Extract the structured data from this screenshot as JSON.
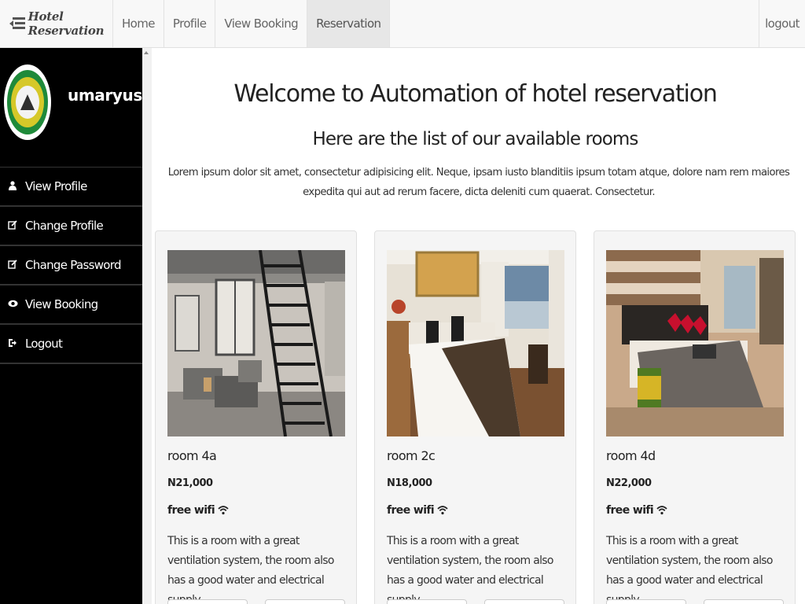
{
  "navbar": {
    "brand": "Hotel Reservation",
    "links": [
      "Home",
      "Profile",
      "View Booking",
      "Reservation"
    ],
    "active_index": 3,
    "logout": "logout"
  },
  "sidebar": {
    "username": "umaryusuf",
    "items": [
      {
        "label": "View Profile",
        "icon": "user-icon"
      },
      {
        "label": "Change Profile",
        "icon": "edit-icon"
      },
      {
        "label": "Change Password",
        "icon": "edit-icon"
      },
      {
        "label": "View Booking",
        "icon": "eye-icon"
      },
      {
        "label": "Logout",
        "icon": "sign-out-icon"
      }
    ]
  },
  "main": {
    "title": "Welcome to Automation of hotel reservation",
    "subtitle": "Here are the list of our available rooms",
    "intro": "Lorem ipsum dolor sit amet, consectetur adipisicing elit. Neque, ipsam iusto blanditiis ipsum totam atque, dolore nam rem maiores expedita qui aut ad rerum facere, dicta deleniti cum quaerat. Consectetur."
  },
  "rooms": [
    {
      "name": "room 4a",
      "price": "N21,000",
      "wifi": "free wifi",
      "description": "This is a room with a great ventilation system, the room also has a good water and electrical supply."
    },
    {
      "name": "room 2c",
      "price": "N18,000",
      "wifi": "free wifi",
      "description": "This is a room with a great ventilation system, the room also has a good water and electrical supply."
    },
    {
      "name": "room 4d",
      "price": "N22,000",
      "wifi": "free wifi",
      "description": "This is a room with a great ventilation system, the room also has a good water and electrical supply."
    }
  ],
  "colors": {
    "sidebar_bg": "#000000",
    "navbar_bg": "#f8f8f8",
    "card_bg": "#f5f5f5"
  }
}
